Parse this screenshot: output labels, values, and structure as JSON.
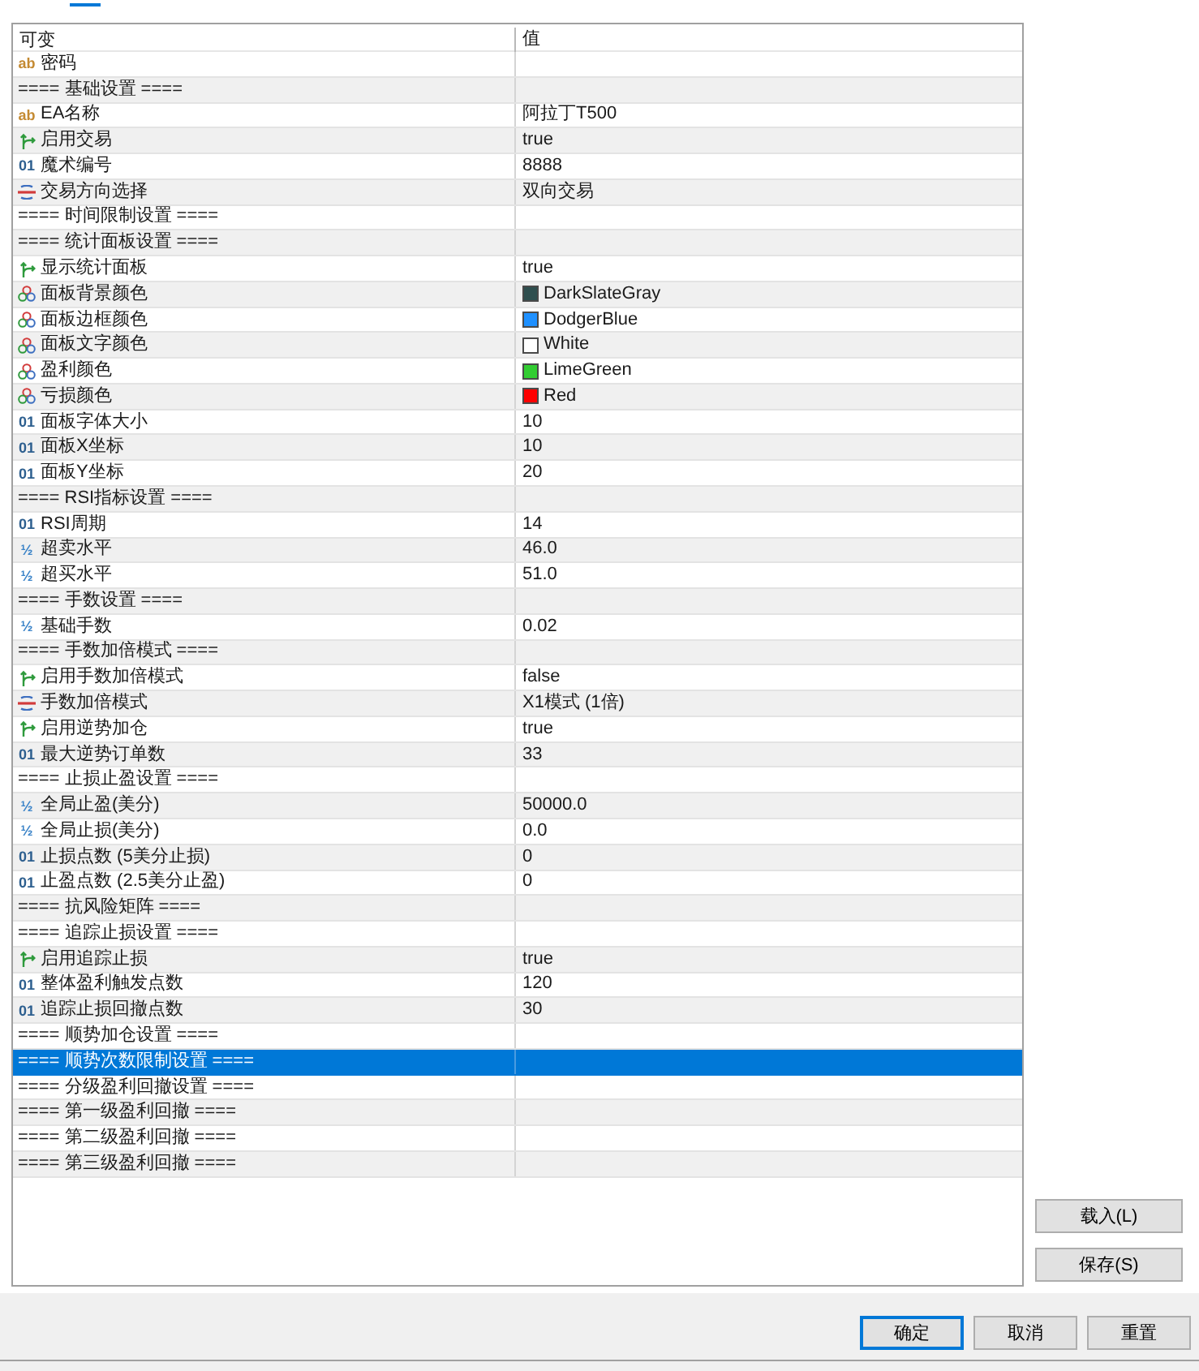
{
  "parameters_table": {
    "columns": [
      "可变",
      "值"
    ],
    "rows": [
      {
        "kind": "string",
        "type_mark": "ab",
        "name": "密码",
        "selected": false
      },
      {
        "kind": "section",
        "name": "==== 基础设置 ====",
        "selected": false
      },
      {
        "kind": "string",
        "type_mark": "ab",
        "name": "EA名称",
        "value": "阿拉丁T500",
        "selected": false
      },
      {
        "kind": "bool",
        "name": "启用交易",
        "value": "true",
        "selected": false
      },
      {
        "kind": "int",
        "type_mark": "01",
        "name": "魔术编号",
        "value": "8888",
        "selected": false
      },
      {
        "kind": "enum",
        "name": "交易方向选择",
        "value": "双向交易",
        "selected": false
      },
      {
        "kind": "section",
        "name": "==== 时间限制设置 ====",
        "selected": false
      },
      {
        "kind": "section",
        "name": "==== 统计面板设置 ====",
        "selected": false
      },
      {
        "kind": "bool",
        "name": "显示统计面板",
        "value": "true",
        "selected": false
      },
      {
        "kind": "color",
        "name": "面板背景颜色",
        "value": "DarkSlateGray",
        "color": "#2f4f4f",
        "selected": false
      },
      {
        "kind": "color",
        "name": "面板边框颜色",
        "value": "DodgerBlue",
        "color": "#1e90ff",
        "selected": false
      },
      {
        "kind": "color",
        "name": "面板文字颜色",
        "value": "White",
        "color": "#ffffff",
        "selected": false
      },
      {
        "kind": "color",
        "name": "盈利颜色",
        "value": "LimeGreen",
        "color": "#32cd32",
        "selected": false
      },
      {
        "kind": "color",
        "name": "亏损颜色",
        "value": "Red",
        "color": "#ff0000",
        "selected": false
      },
      {
        "kind": "int",
        "type_mark": "01",
        "name": "面板字体大小",
        "value": "10",
        "selected": false
      },
      {
        "kind": "int",
        "type_mark": "01",
        "name": "面板X坐标",
        "value": "10",
        "selected": false
      },
      {
        "kind": "int",
        "type_mark": "01",
        "name": "面板Y坐标",
        "value": "20",
        "selected": false
      },
      {
        "kind": "section",
        "name": "==== RSI指标设置 ====",
        "selected": false
      },
      {
        "kind": "int",
        "type_mark": "01",
        "name": "RSI周期",
        "value": "14",
        "selected": false
      },
      {
        "kind": "double",
        "type_mark": "½",
        "name": "超卖水平",
        "value": "46.0",
        "selected": false
      },
      {
        "kind": "double",
        "type_mark": "½",
        "name": "超买水平",
        "value": "51.0",
        "selected": false
      },
      {
        "kind": "section",
        "name": "==== 手数设置 ====",
        "selected": false
      },
      {
        "kind": "double",
        "type_mark": "½",
        "name": "基础手数",
        "value": "0.02",
        "selected": false
      },
      {
        "kind": "section",
        "name": "==== 手数加倍模式 ====",
        "selected": false
      },
      {
        "kind": "bool",
        "name": "启用手数加倍模式",
        "value": "false",
        "selected": false
      },
      {
        "kind": "enum",
        "name": "手数加倍模式",
        "value": "X1模式 (1倍)",
        "selected": false
      },
      {
        "kind": "bool",
        "name": "启用逆势加仓",
        "value": "true",
        "selected": false
      },
      {
        "kind": "int",
        "type_mark": "01",
        "name": "最大逆势订单数",
        "value": "33",
        "selected": false
      },
      {
        "kind": "section",
        "name": "==== 止损止盈设置 ====",
        "selected": false
      },
      {
        "kind": "double",
        "type_mark": "½",
        "name": "全局止盈(美分)",
        "value": "50000.0",
        "selected": false
      },
      {
        "kind": "double",
        "type_mark": "½",
        "name": "全局止损(美分)",
        "value": "0.0",
        "selected": false
      },
      {
        "kind": "int",
        "type_mark": "01",
        "name": "止损点数 (5美分止损)",
        "value": "0",
        "selected": false
      },
      {
        "kind": "int",
        "type_mark": "01",
        "name": "止盈点数 (2.5美分止盈)",
        "value": "0",
        "selected": false
      },
      {
        "kind": "section",
        "name": "==== 抗风险矩阵 ====",
        "selected": false
      },
      {
        "kind": "section",
        "name": "==== 追踪止损设置 ====",
        "selected": false
      },
      {
        "kind": "bool",
        "name": "启用追踪止损",
        "value": "true",
        "selected": false
      },
      {
        "kind": "int",
        "type_mark": "01",
        "name": "整体盈利触发点数",
        "value": "120",
        "selected": false
      },
      {
        "kind": "int",
        "type_mark": "01",
        "name": "追踪止损回撤点数",
        "value": "30",
        "selected": false
      },
      {
        "kind": "section",
        "name": "==== 顺势加仓设置 ====",
        "selected": false
      },
      {
        "kind": "section",
        "name": "==== 顺势次数限制设置 ====",
        "selected": true
      },
      {
        "kind": "section",
        "name": "==== 分级盈利回撤设置 ====",
        "selected": false
      },
      {
        "kind": "section",
        "name": "==== 第一级盈利回撤 ====",
        "selected": false
      },
      {
        "kind": "section",
        "name": "==== 第二级盈利回撤 ====",
        "selected": false
      },
      {
        "kind": "section",
        "name": "==== 第三级盈利回撤 ====",
        "selected": false
      }
    ]
  },
  "side_buttons": [
    "载入(L)",
    "保存(S)"
  ],
  "buttons": [
    {
      "label": "确定",
      "focused": true
    },
    {
      "label": "取消",
      "focused": false
    },
    {
      "label": "重置",
      "focused": false
    }
  ]
}
